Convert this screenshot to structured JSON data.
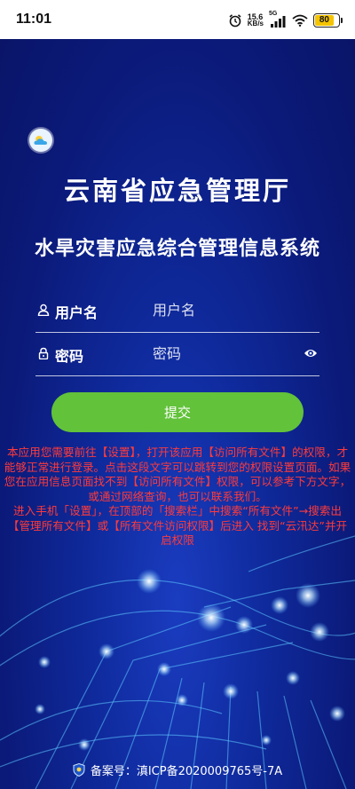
{
  "status_bar": {
    "time": "11:01",
    "net_speed_value": "15.6",
    "net_speed_unit": "KB/s",
    "network_type": "5G",
    "battery_level": "80",
    "icons": [
      "alarm-icon",
      "signal-icon",
      "wifi-icon",
      "battery-icon"
    ]
  },
  "header": {
    "logo_icon": "cloud-icon",
    "title": "云南省应急管理厅",
    "subtitle": "水旱灾害应急综合管理信息系统"
  },
  "login": {
    "username_label": "用户名",
    "username_placeholder": "用户名",
    "password_label": "密码",
    "password_placeholder": "密码",
    "submit_label": "提交"
  },
  "notice": {
    "paragraph1": "本应用您需要前往【设置】，打开该应用【访问所有文件】的权限，才能够正常进行登录。点击这段文字可以跳转到您的权限设置页面。如果您在应用信息页面找不到【访问所有文件】权限，可以参考下方文字，或通过网络查询，也可以联系我们。",
    "paragraph2": "进入手机「设置」，在顶部的「搜索栏」中搜索“所有文件”→搜索出【管理所有文件】或【所有文件访问权限】后进入 找到“云汛达”并开启权限"
  },
  "footer": {
    "icon": "police-badge-icon",
    "text": "备案号：滇ICP备2020009765号-7A"
  },
  "colors": {
    "background": "#0b1a7a",
    "submit_button": "#62c23a",
    "notice_text": "#ff3b3b",
    "battery": "#f5c400"
  }
}
